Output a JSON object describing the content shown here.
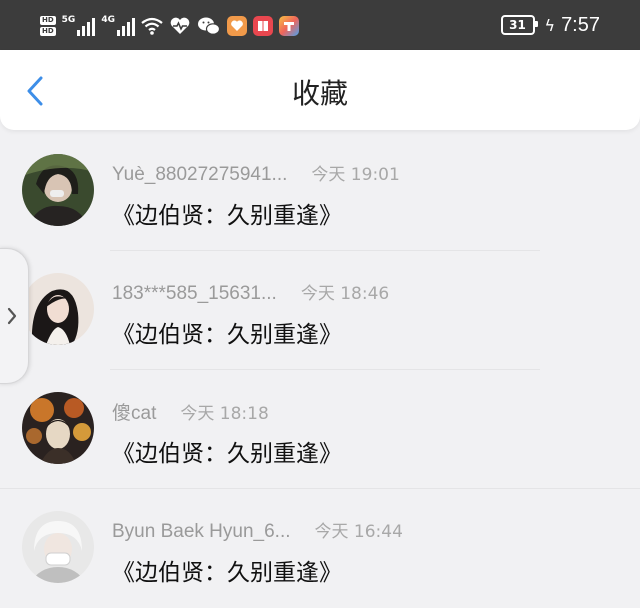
{
  "status_bar": {
    "hd_labels": [
      "HD",
      "HD"
    ],
    "network_1": "5G",
    "network_2": "4G",
    "battery_level": "31",
    "time": "7:57",
    "icons": [
      "signal-icon",
      "wifi-icon",
      "heart-icon",
      "wechat-icon",
      "app-icon",
      "book-app-icon",
      "store-app-icon"
    ]
  },
  "header": {
    "back_icon": "chevron-left-icon",
    "title": "收藏"
  },
  "side_handle": {
    "icon": "chevron-right-icon"
  },
  "favorites": [
    {
      "username": "Yuè_88027275941...",
      "time": "今天 19:01",
      "content": "《边伯贤：久别重逢》",
      "avatar_colors": [
        "#2f3a2a",
        "#7a8a5a"
      ]
    },
    {
      "username": "183***585_15631...",
      "time": "今天 18:46",
      "content": "《边伯贤：久别重逢》",
      "avatar_colors": [
        "#1a1616",
        "#e8dcd4"
      ]
    },
    {
      "username": "傻cat",
      "time": "今天 18:18",
      "content": "《边伯贤：久别重逢》",
      "avatar_colors": [
        "#2a2320",
        "#c9762a"
      ]
    },
    {
      "username": "Byun Baek Hyun_6...",
      "time": "今天 16:44",
      "content": "《边伯贤：久别重逢》",
      "avatar_colors": [
        "#dcdcdc",
        "#f4f4f4"
      ]
    }
  ],
  "colors": {
    "accent": "#3d8ee8",
    "status_bar_bg": "#3c3c3c",
    "page_bg": "#f1f1f3",
    "meta_text": "#9a9a9a"
  }
}
